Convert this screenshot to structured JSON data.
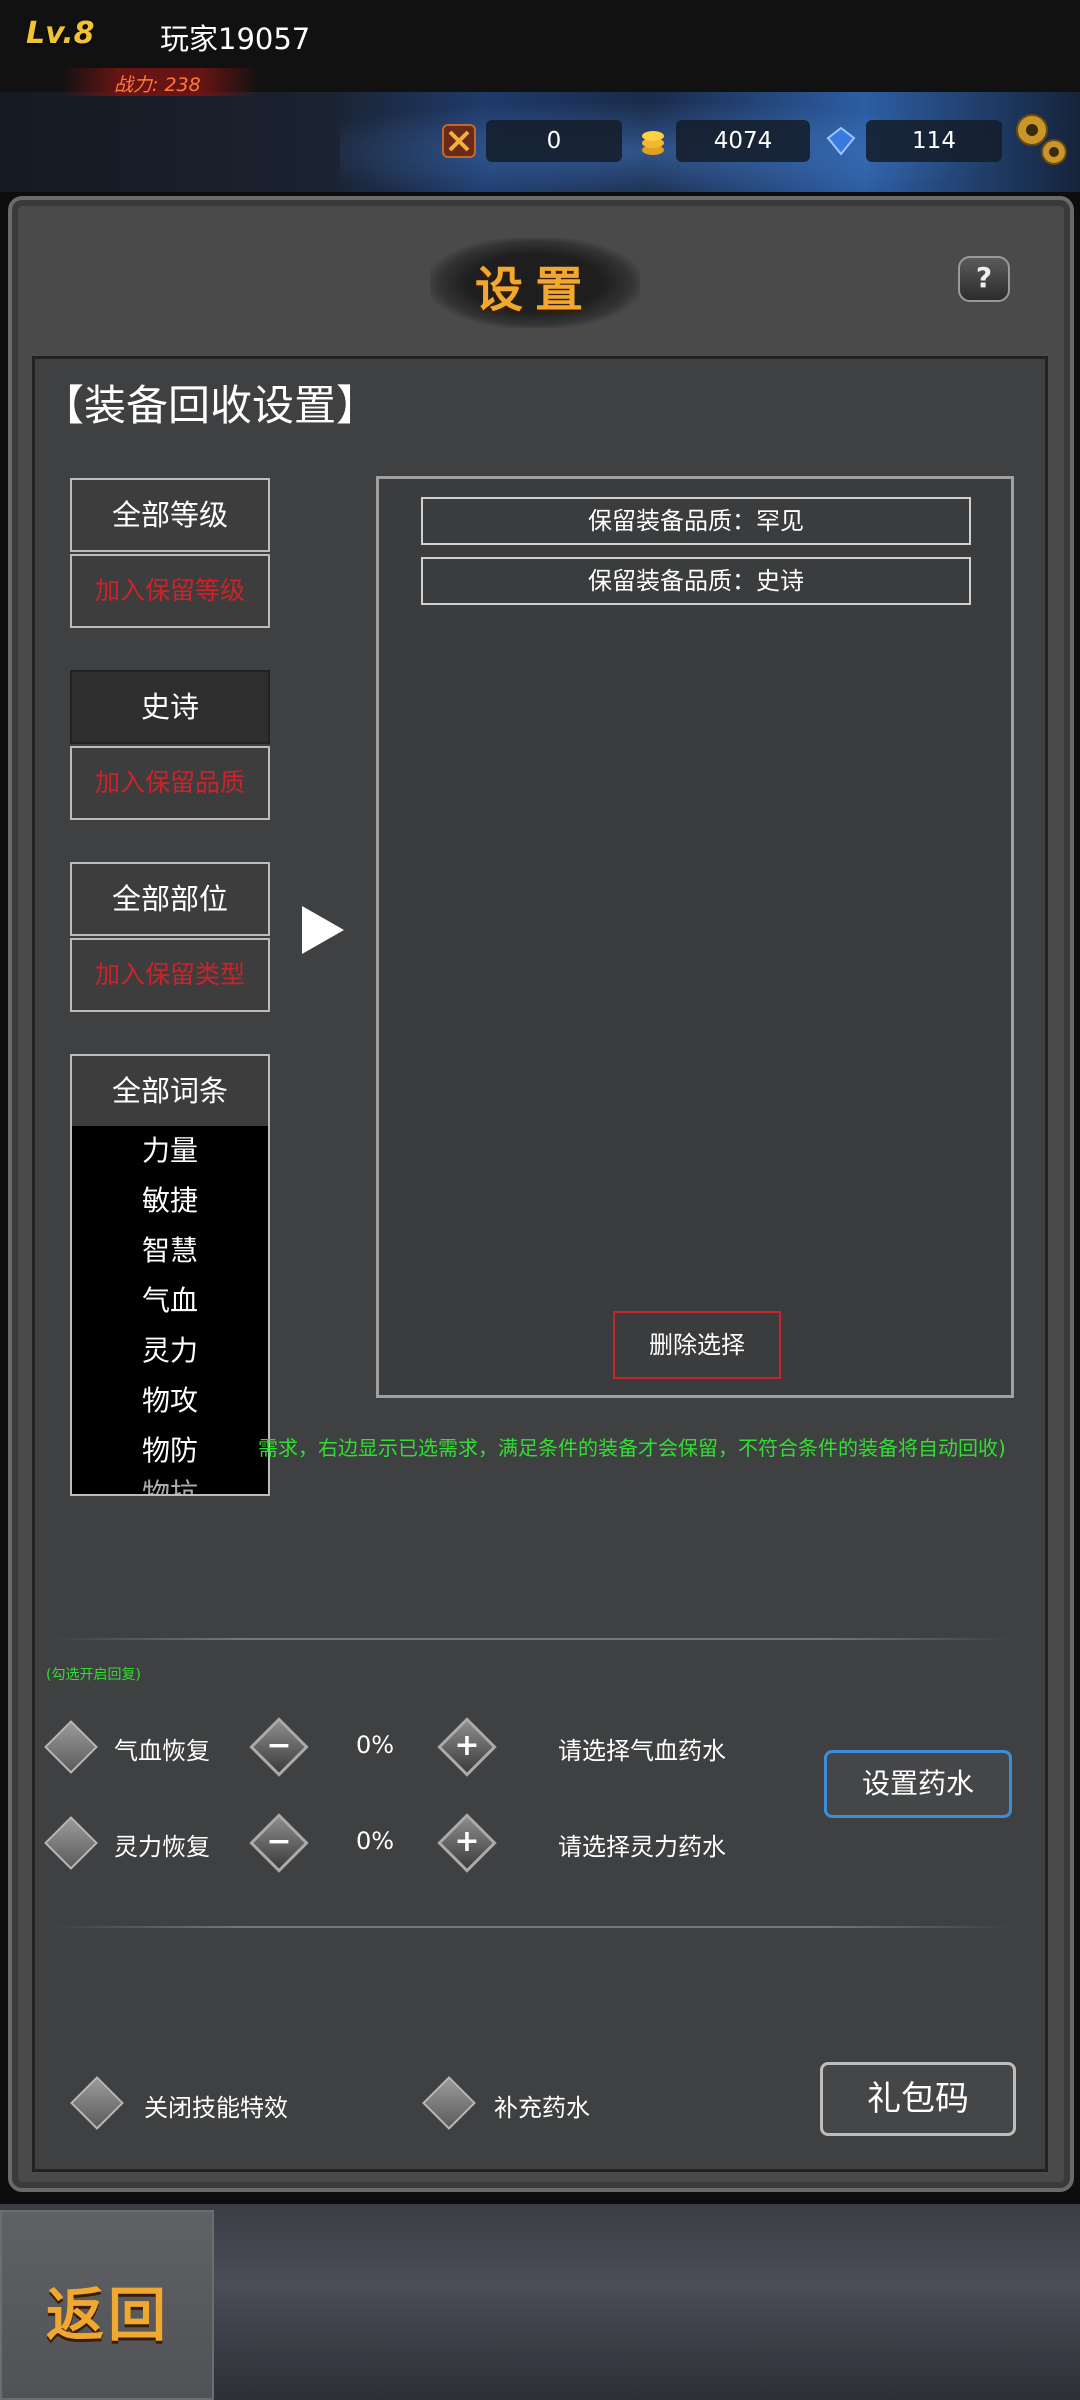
{
  "topbar": {
    "level": "Lv.8",
    "player_name": "玩家19057",
    "power": "战力: 238",
    "resources": [
      {
        "icon": "sword-badge-icon",
        "value": "0"
      },
      {
        "icon": "gold-coins-icon",
        "value": "4074"
      },
      {
        "icon": "blue-gem-icon",
        "value": "114"
      }
    ]
  },
  "panel": {
    "title": "设置",
    "help": "?",
    "section_title": "【装备回收设置】",
    "left": {
      "level_select": "全部等级",
      "level_add": "加入保留等级",
      "quality_select": "史诗",
      "quality_add": "加入保留品质",
      "slot_select": "全部部位",
      "slot_add": "加入保留类型",
      "affix_select": "全部词条",
      "affix_options": [
        "力量",
        "敏捷",
        "智慧",
        "气血",
        "灵力",
        "物攻",
        "物防",
        "物抗"
      ]
    },
    "right": {
      "kept": [
        "保留装备品质：罕见",
        "保留装备品质：史诗"
      ],
      "delete_button": "删除选择"
    },
    "hint": "需求，右边显示已选需求，满足条件的装备才会保留，不符合条件的装备将自动回收)",
    "recovery_hint": "(勾选开启回复)",
    "recovery": [
      {
        "label": "气血恢复",
        "minus": "−",
        "percent": "0%",
        "plus": "+",
        "potion": "请选择气血药水"
      },
      {
        "label": "灵力恢复",
        "minus": "−",
        "percent": "0%",
        "plus": "+",
        "potion": "请选择灵力药水"
      }
    ],
    "set_potion_button": "设置药水",
    "options": {
      "close_effects": "关闭技能特效",
      "refill_potion": "补充药水"
    },
    "gift_code_button": "礼包码"
  },
  "bottom": {
    "back_button": "返回"
  },
  "colors": {
    "accent_orange": "#f0a830",
    "red": "#c8242a",
    "green": "#33dd33",
    "blue": "#3a8fd8"
  }
}
